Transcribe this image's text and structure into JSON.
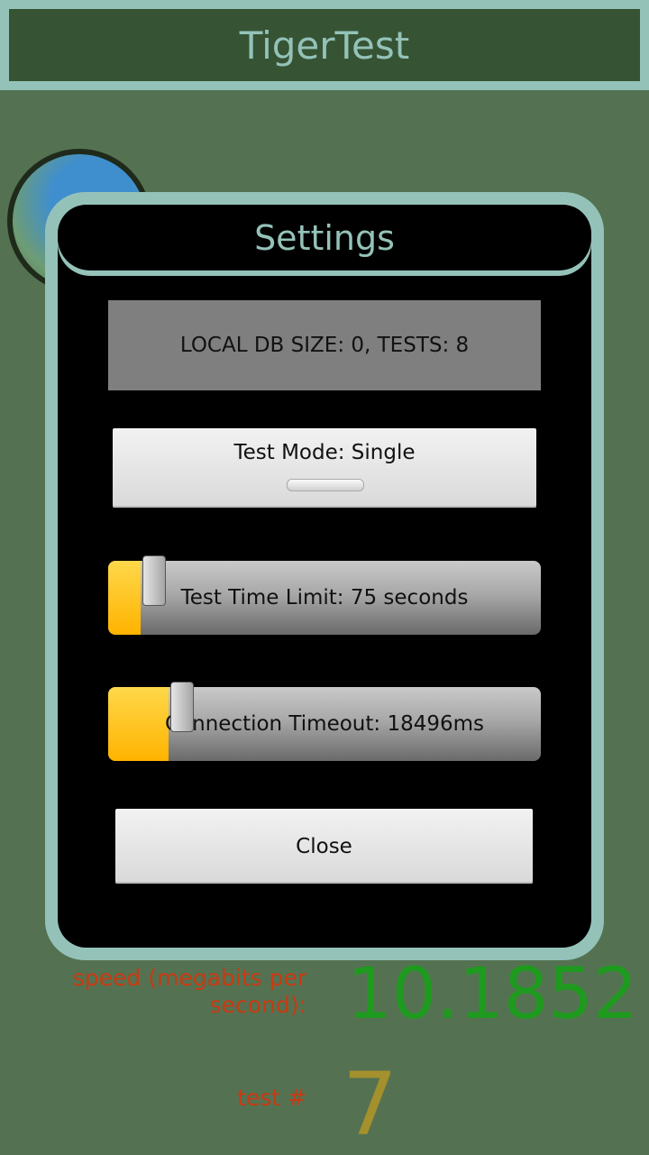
{
  "app": {
    "title": "TigerTest"
  },
  "background": {
    "speed_label": "speed (megabits per second):",
    "speed_value": "10.1852",
    "test_label": "test #",
    "test_value": "7"
  },
  "dialog": {
    "title": "Settings",
    "db_info": "LOCAL DB SIZE: 0, TESTS: 8",
    "test_mode_label": "Test Mode: Single",
    "test_time_slider": {
      "label": "Test Time Limit: 75 seconds",
      "fraction": 0.075
    },
    "connection_timeout_slider": {
      "label": "Connection Timeout: 18496ms",
      "fraction": 0.14
    },
    "close_label": "Close"
  },
  "colors": {
    "background": "#547252",
    "accent": "#94c2b9",
    "titlebar": "#365434",
    "speed_value": "#1e9b1e",
    "test_value": "#a4902c",
    "label_red": "#c83a12",
    "slider_fill": "#ffc107"
  }
}
